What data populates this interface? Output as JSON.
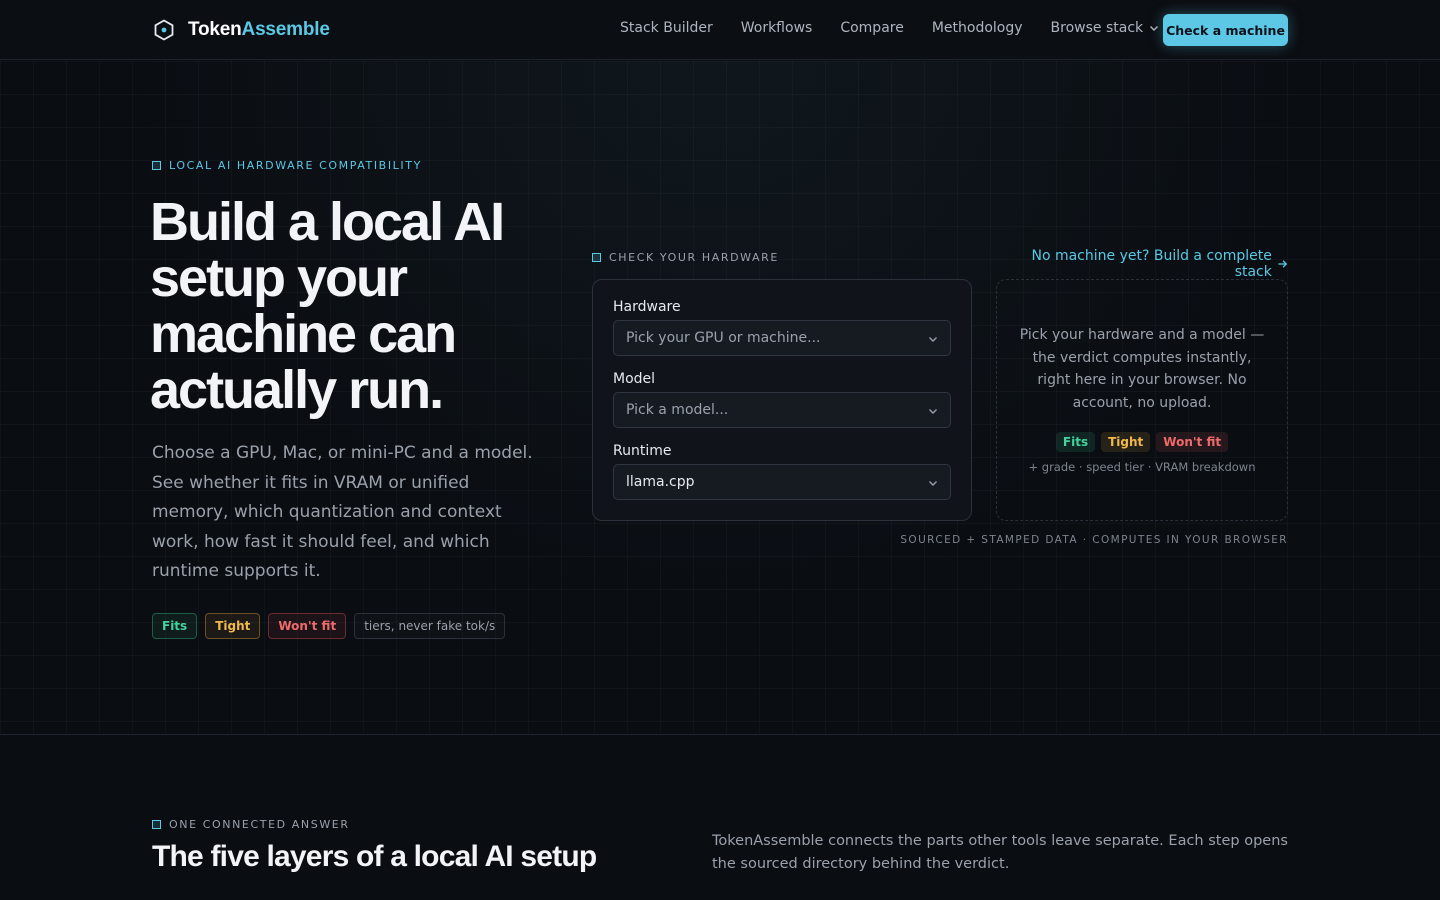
{
  "brand": {
    "name_part1": "Token",
    "name_part2": "Assemble",
    "accent_color": "#5bc8e4"
  },
  "nav": {
    "items": [
      "Stack Builder",
      "Workflows",
      "Compare",
      "Methodology"
    ],
    "dropdown_label": "Browse stack",
    "cta_label": "Check a machine"
  },
  "hero": {
    "eyebrow": "LOCAL AI HARDWARE COMPATIBILITY",
    "title": "Build a local AI setup your machine can actually run.",
    "subtitle": "Choose a GPU, Mac, or mini-PC and a model. See whether it fits in VRAM or unified memory, which quantization and context work, how fast it should feel, and which runtime supports it.",
    "chips": {
      "fits": "Fits",
      "tight": "Tight",
      "wont_fit": "Won't fit",
      "note": "tiers, never fake tok/s"
    }
  },
  "checker": {
    "eyebrow": "CHECK YOUR HARDWARE",
    "build_link": "No machine yet? Build a complete stack",
    "hardware_label": "Hardware",
    "hardware_placeholder": "Pick your GPU or machine...",
    "model_label": "Model",
    "model_placeholder": "Pick a model...",
    "runtime_label": "Runtime",
    "runtime_value": "llama.cpp",
    "preview_text": "Pick your hardware and a model — the verdict computes instantly, right here in your browser. No account, no upload.",
    "preview_chips": {
      "fits": "Fits",
      "tight": "Tight",
      "wont_fit": "Won't fit"
    },
    "preview_extra": "+ grade · speed tier · VRAM breakdown",
    "stamp": "SOURCED + STAMPED DATA · COMPUTES IN YOUR BROWSER"
  },
  "section2": {
    "eyebrow": "ONE CONNECTED ANSWER",
    "title": "The five layers of a local AI setup",
    "description": "TokenAssemble connects the parts other tools leave separate. Each step opens the sourced directory behind the verdict."
  }
}
